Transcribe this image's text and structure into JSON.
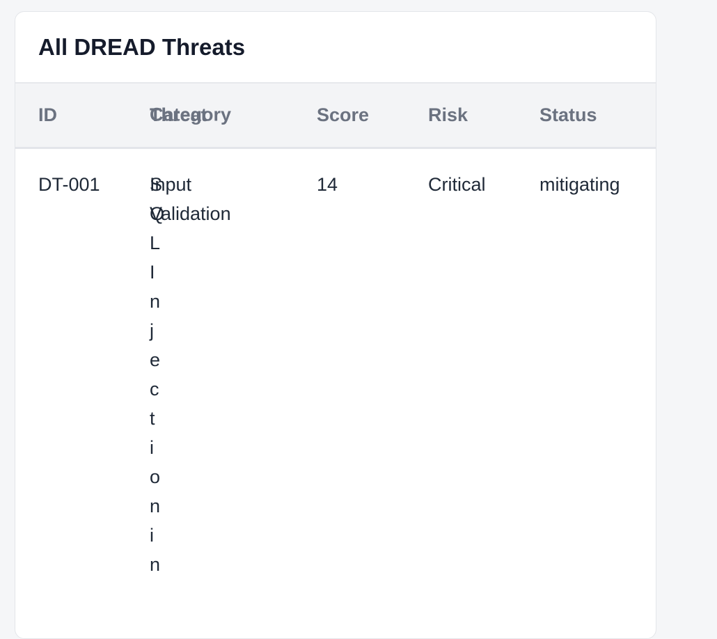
{
  "card": {
    "title": "All DREAD Threats"
  },
  "table": {
    "headers": {
      "id": "ID",
      "threat": "Threat",
      "category": "Category",
      "score": "Score",
      "risk": "Risk",
      "status": "Status"
    },
    "rows": [
      {
        "id": "DT-001",
        "threat": "SQL Injection in",
        "category": "Input Validation",
        "score": "14",
        "risk": "Critical",
        "status": "mitigating"
      }
    ]
  }
}
